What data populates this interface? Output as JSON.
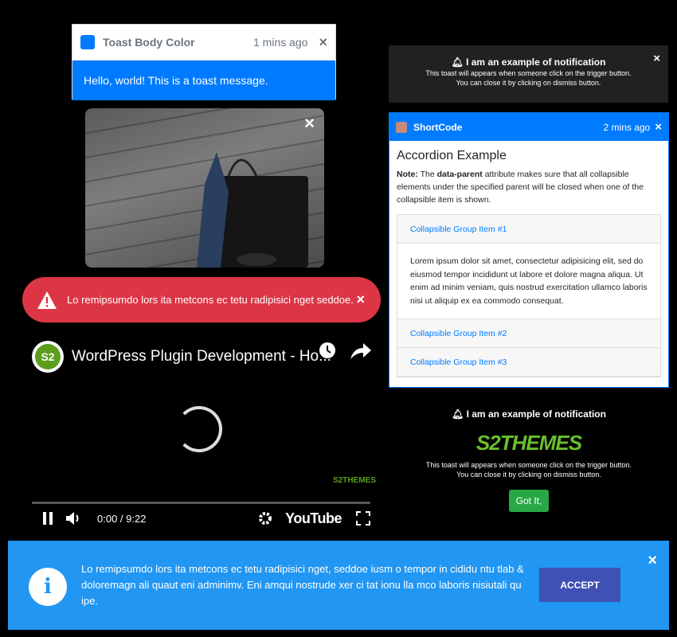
{
  "toast_body_color": {
    "title": "Toast Body Color",
    "time": "1 mins ago",
    "close": "×",
    "message": "Hello, world! This is a toast message.",
    "accent": "#007bff"
  },
  "image_toast": {
    "close": "×",
    "image_icon": "shopping-bag-photo"
  },
  "red_alert": {
    "message": "Lo remipsumdo lors ita metcons ec tetu radipisici nget seddoe.",
    "close": "×",
    "color": "#dc3545",
    "icon": "warning-icon"
  },
  "video": {
    "avatar_text": "S2",
    "title": "WordPress Plugin Development - Ho...",
    "current_time": "0:00 / 9:22",
    "brand": "YouTube",
    "watermark": "S2THEMES",
    "progress": 0
  },
  "notification_top": {
    "heading": "I am an example of notification",
    "line1": "This toast will appears when someone click on the trigger button.",
    "line2": "You can close it by clicking on dismiss button.",
    "close": "×"
  },
  "shortcode_toast": {
    "name": "ShortCode",
    "time": "2 mins ago",
    "close": "×",
    "heading": "Accordion Example",
    "note_label": "Note:",
    "note_pre": " The ",
    "note_bold": "data-parent",
    "note_post": " attribute makes sure that all collapsible elements under the specified parent will be closed when one of the collapsible item is shown.",
    "items": [
      {
        "label": "Collapsible Group Item #1"
      },
      {
        "label": "Collapsible Group Item #2"
      },
      {
        "label": "Collapsible Group Item #3"
      }
    ],
    "panel_text": "Lorem ipsum dolor sit amet, consectetur adipisicing elit, sed do eiusmod tempor incididunt ut labore et dolore magna aliqua. Ut enim ad minim veniam, quis nostrud exercitation ullamco laboris nisi ut aliquip ex ea commodo consequat."
  },
  "notification_bottom": {
    "heading": "I am an example of notification",
    "logo_text": "S2THEMES",
    "line1": "This toast will appears when someone click on the trigger button.",
    "line2": "You can close it by clicking on dismiss button.",
    "button": "Got It,"
  },
  "info_bar": {
    "icon_glyph": "i",
    "message": "Lo remipsumdo lors ita metcons ec tetu radipisici nget, seddoe iusm o tempor in cididu ntu tlab & doloremagn ali quaut eni adminimv. Eni amqui nostrude xer ci tat ionu lla mco laboris nisiutali qu ipe.",
    "button": "ACCEPT",
    "close": "×",
    "color": "#2196f3"
  }
}
